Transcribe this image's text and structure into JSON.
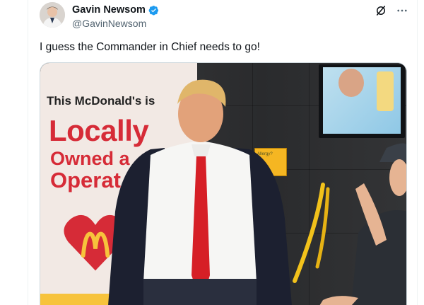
{
  "post": {
    "author": {
      "display_name": "Gavin Newsom",
      "handle": "@GavinNewsom",
      "verified_color": "#1d9bf0"
    },
    "text": "I guess the Commander in Chief needs to go!",
    "actions": {
      "grok_icon": "grok-icon",
      "more_icon": "more-icon"
    },
    "media": {
      "sign_line_1": "This McDonald's is",
      "sign_line_2": "Locally",
      "sign_line_3": "Owned a",
      "sign_line_4": "Operat",
      "allergy_sign": "Allergy?"
    }
  },
  "colors": {
    "text_primary": "#0f1419",
    "text_secondary": "#536471",
    "mcdonalds_red": "#d62b37",
    "mcdonalds_yellow": "#f7c33c"
  }
}
